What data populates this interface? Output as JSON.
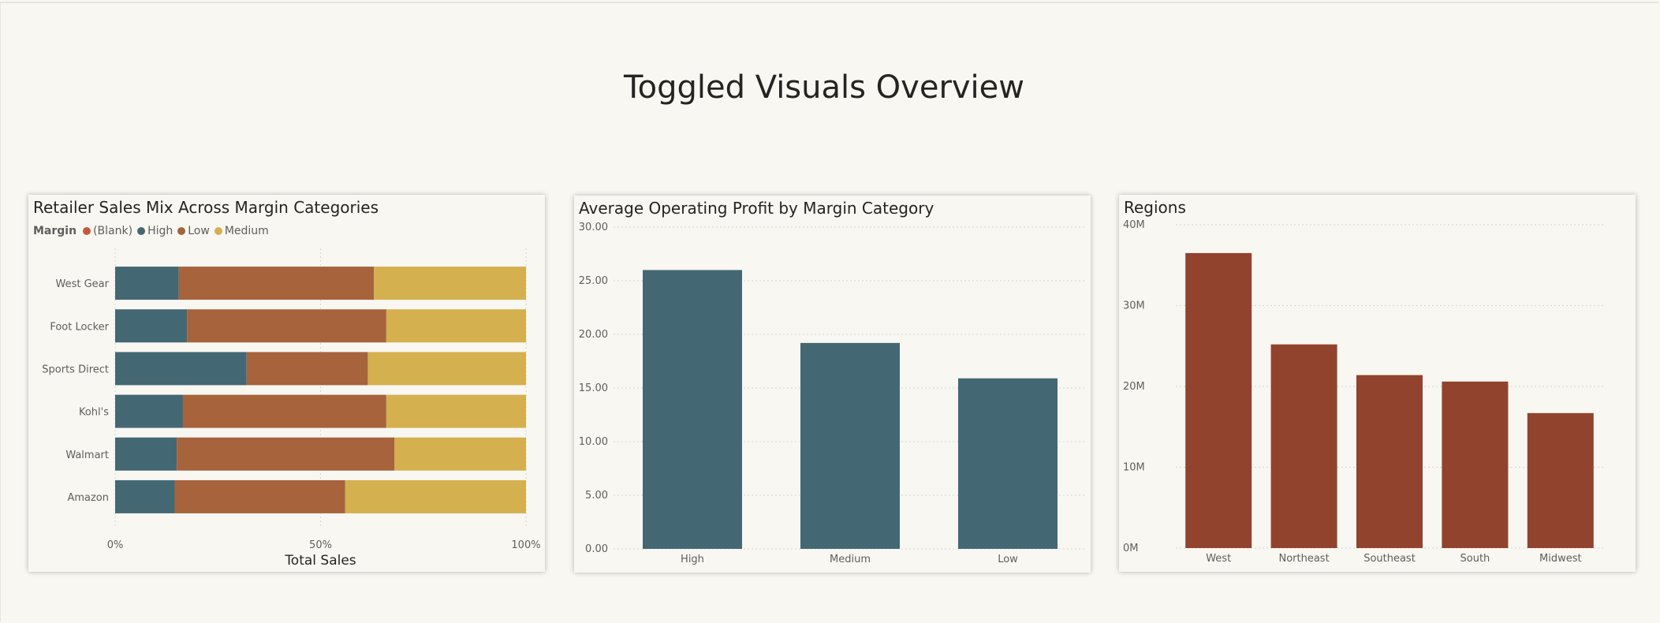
{
  "page": {
    "title": "Toggled Visuals Overview"
  },
  "colors": {
    "blank": "#c5593f",
    "high": "#436873",
    "low": "#a6633c",
    "medium": "#d4b04e",
    "region_bar": "#91432e",
    "background": "#f9f7f2"
  },
  "legend": {
    "title": "Margin",
    "items": [
      {
        "label": "(Blank)",
        "color": "#c5593f"
      },
      {
        "label": "High",
        "color": "#436873"
      },
      {
        "label": "Low",
        "color": "#a6633c"
      },
      {
        "label": "Medium",
        "color": "#d4b04e"
      }
    ]
  },
  "chart_data": [
    {
      "type": "bar",
      "orientation": "horizontal",
      "stacked": "100%",
      "title": "Retailer Sales Mix Across Margin Categories",
      "xlabel": "Total Sales",
      "x_ticks": [
        "0%",
        "50%",
        "100%"
      ],
      "categories": [
        "West Gear",
        "Foot Locker",
        "Sports Direct",
        "Kohl's",
        "Walmart",
        "Amazon"
      ],
      "series": [
        {
          "name": "High",
          "color": "#436873",
          "values": [
            15.5,
            17.5,
            32,
            16.5,
            15,
            14.5
          ]
        },
        {
          "name": "Low",
          "color": "#a6633c",
          "values": [
            47.5,
            48.5,
            29.5,
            49.5,
            53,
            41.5
          ]
        },
        {
          "name": "Medium",
          "color": "#d4b04e",
          "values": [
            37,
            34,
            38.5,
            34,
            32,
            44
          ]
        }
      ],
      "xlim": [
        0,
        100
      ],
      "grid": true,
      "legend_position": "top-left"
    },
    {
      "type": "bar",
      "title": "Average Operating Profit by Margin Category",
      "categories": [
        "High",
        "Medium",
        "Low"
      ],
      "values": [
        26.0,
        19.2,
        15.9
      ],
      "y_ticks": [
        "0.00",
        "5.00",
        "10.00",
        "15.00",
        "20.00",
        "25.00",
        "30.00"
      ],
      "ylim": [
        0,
        30
      ],
      "color": "#436873",
      "grid": true
    },
    {
      "type": "bar",
      "title": "Regions",
      "categories": [
        "West",
        "Northeast",
        "Southeast",
        "South",
        "Midwest"
      ],
      "values": [
        36.5,
        25.2,
        21.4,
        20.6,
        16.7
      ],
      "value_unit": "M",
      "y_ticks": [
        "0M",
        "10M",
        "20M",
        "30M",
        "40M"
      ],
      "ylim": [
        0,
        40
      ],
      "color": "#91432e",
      "grid": true
    }
  ]
}
